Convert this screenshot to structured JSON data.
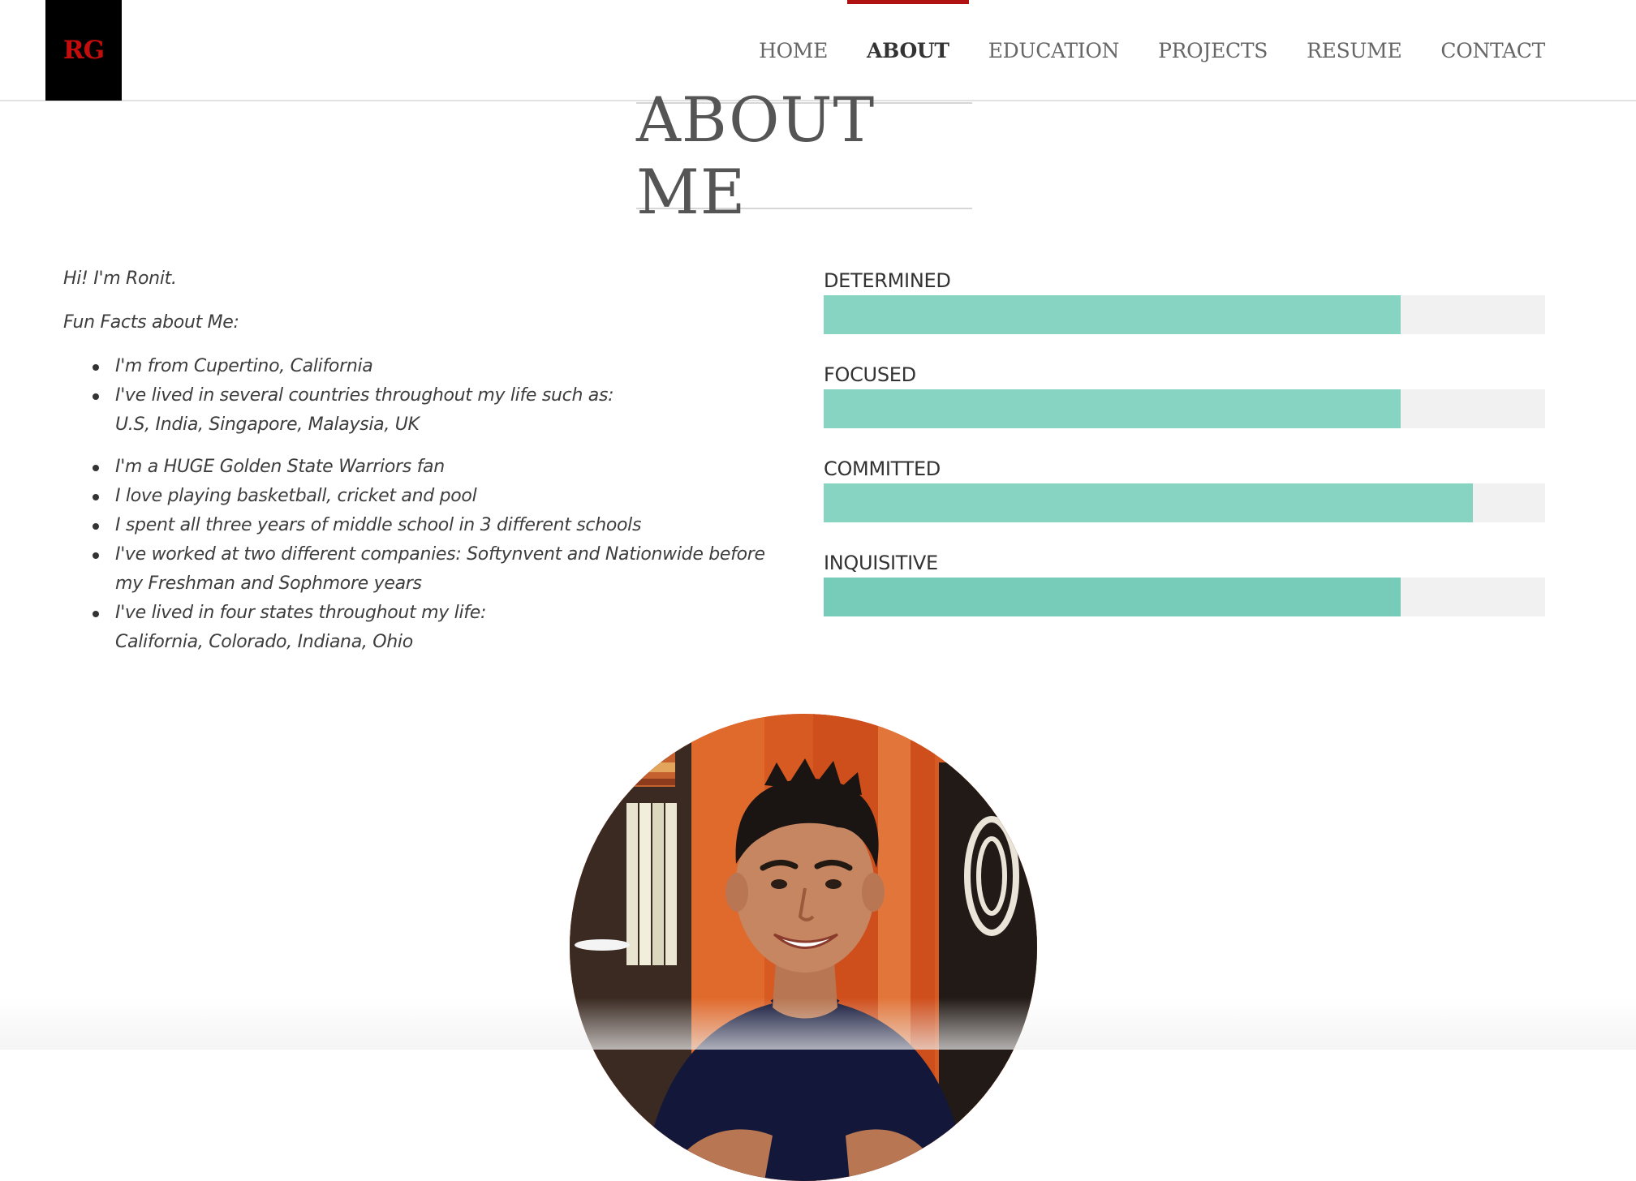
{
  "logo": {
    "text": "RG"
  },
  "nav": {
    "items": [
      {
        "label": "HOME"
      },
      {
        "label": "ABOUT"
      },
      {
        "label": "EDUCATION"
      },
      {
        "label": "PROJECTS"
      },
      {
        "label": "RESUME"
      },
      {
        "label": "CONTACT"
      }
    ],
    "active": "ABOUT"
  },
  "page_title": "ABOUT ME",
  "about": {
    "greeting": "Hi! I'm Ronit.",
    "facts_heading": "Fun Facts about Me:",
    "facts": [
      {
        "line1": "I'm from Cupertino, California",
        "line2": ""
      },
      {
        "line1": "I've lived in several countries throughout my life such as:",
        "line2": "U.S, India, Singapore, Malaysia, UK"
      },
      {
        "line1": "I'm a HUGE Golden State Warriors fan",
        "line2": ""
      },
      {
        "line1": "I love playing basketball, cricket and pool",
        "line2": ""
      },
      {
        "line1": "I spent all three years of middle school in 3 different schools",
        "line2": ""
      },
      {
        "line1": "I've worked at two different companies: Softynvent and Nationwide before",
        "line2": "my Freshman and Sophmore years"
      },
      {
        "line1": "I've lived in four states throughout my life:",
        "line2": "California, Colorado, Indiana, Ohio"
      }
    ]
  },
  "skills": [
    {
      "label": "DETERMINED",
      "level": 0.8
    },
    {
      "label": "FOCUSED",
      "level": 0.8
    },
    {
      "label": "COMMITTED",
      "level": 0.9
    },
    {
      "label": "INQUISITIVE",
      "level": 0.8
    }
  ],
  "colors": {
    "accent": "#b01212",
    "logo_text": "#c30d0d",
    "bar_fill": "#88d4c3",
    "bar_track": "#f1f1f1"
  },
  "photo": {
    "subject": "profile-photo"
  }
}
